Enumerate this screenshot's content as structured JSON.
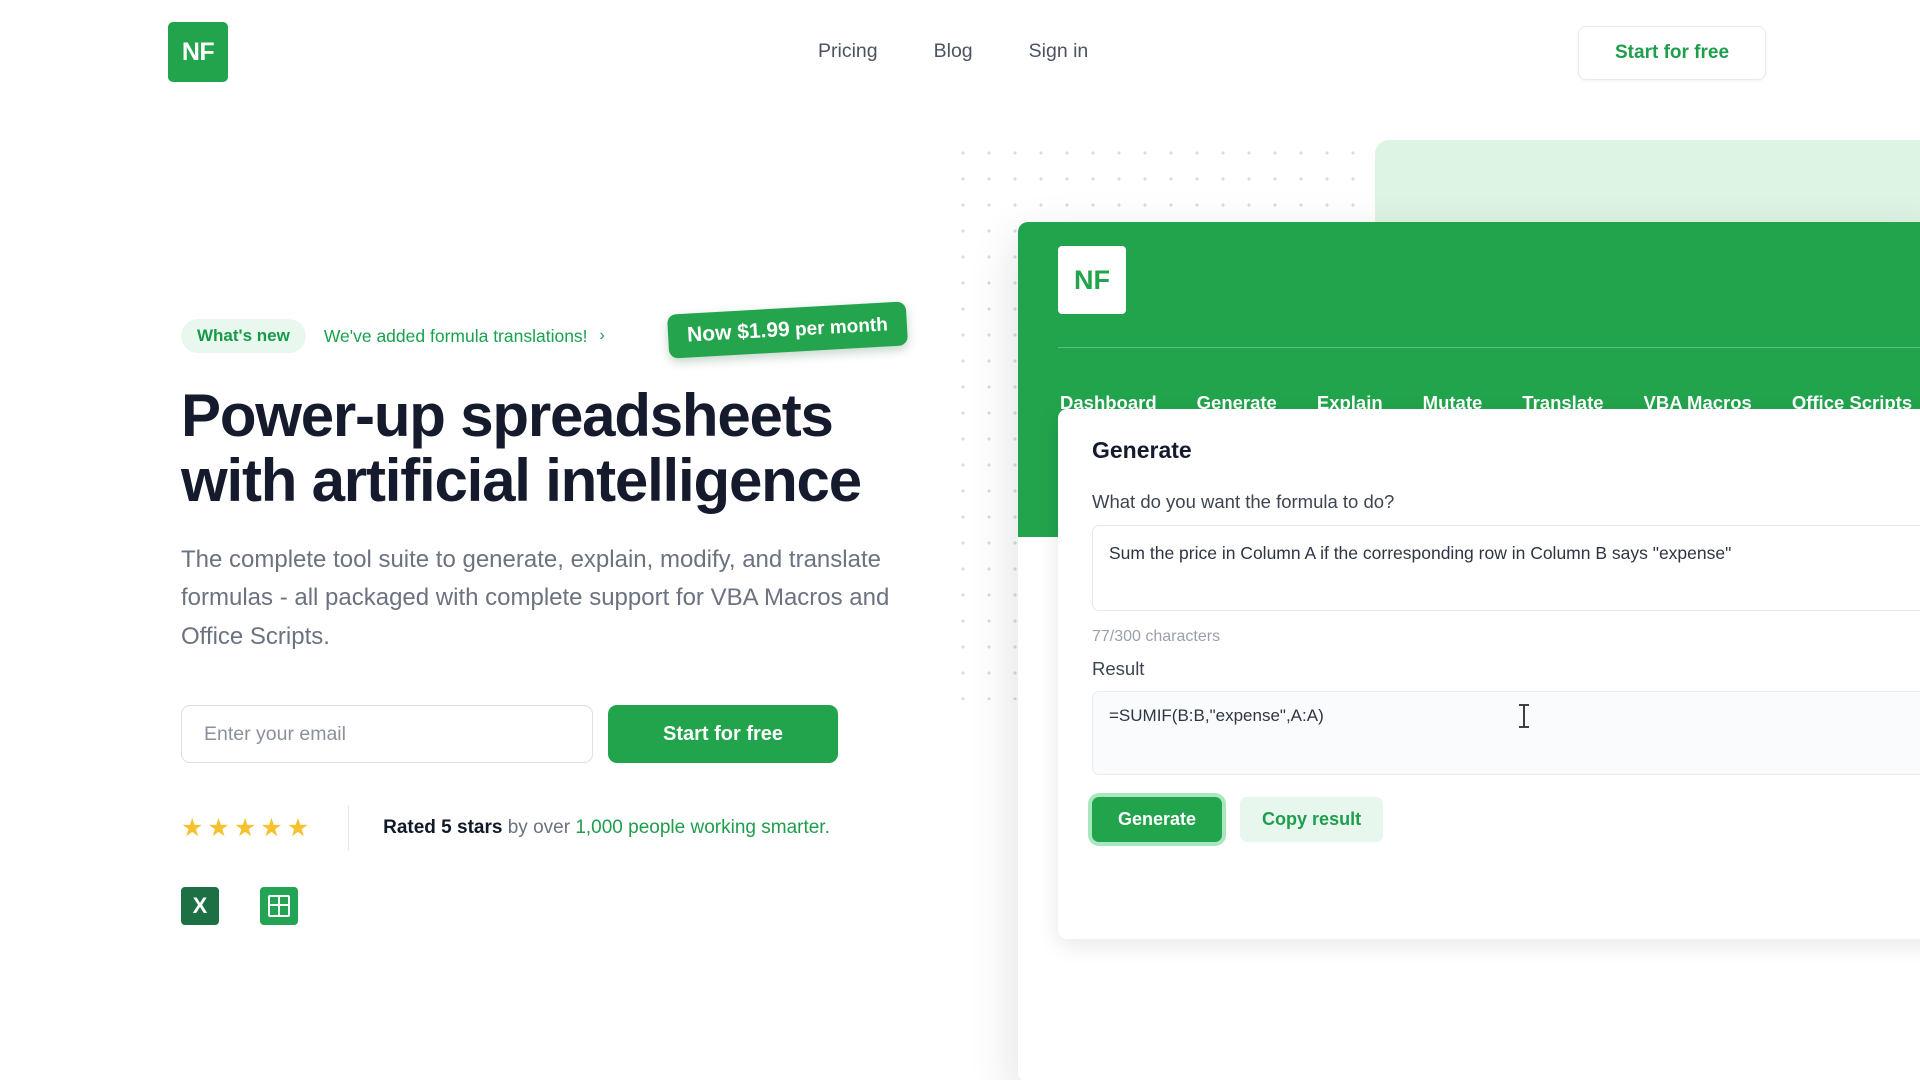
{
  "brand": {
    "logo_text": "NF",
    "accent_green": "#22a44c",
    "dark_navy": "#151b2d",
    "muted_gray": "#6b7280",
    "star_yellow": "#f5c12e"
  },
  "header": {
    "nav": [
      {
        "label": "Pricing"
      },
      {
        "label": "Blog"
      },
      {
        "label": "Sign in"
      }
    ],
    "cta_label": "Start for free"
  },
  "hero": {
    "whats_new_label": "What's new",
    "announce_text": "We've added formula translations!",
    "announce_chevron": "chevron-right-icon",
    "price_badge_strong": "Now $1.99",
    "price_badge_rest": " per month",
    "headline_line1": "Power-up spreadsheets",
    "headline_line2": "with artificial intelligence",
    "subheadline": "The complete tool suite to generate, explain, modify, and translate formulas - all packaged with complete support for VBA Macros and Office Scripts.",
    "email_placeholder": "Enter your email",
    "email_value": "",
    "signup_label": "Start for free",
    "stars": "★★★★★",
    "star_count": 5,
    "rating_bold": "Rated 5 stars",
    "rating_mid": " by over ",
    "rating_green": "1,000 people working smarter.",
    "app_badges": [
      {
        "name": "excel-icon",
        "glyph": "X"
      },
      {
        "name": "google-sheets-icon",
        "glyph": ""
      }
    ]
  },
  "app_mock": {
    "logo_text": "NF",
    "tabs": [
      {
        "label": "Dashboard"
      },
      {
        "label": "Generate"
      },
      {
        "label": "Explain"
      },
      {
        "label": "Mutate"
      },
      {
        "label": "Translate"
      },
      {
        "label": "VBA Macros"
      },
      {
        "label": "Office Scripts"
      }
    ],
    "card": {
      "title": "Generate",
      "prompt_label": "What do you want the formula to do?",
      "prompt_value": "Sum the price in Column A if the corresponding row in Column B says \"expense\"",
      "char_count": "77/300 characters",
      "result_label": "Result",
      "result_value": "=SUMIF(B:B,\"expense\",A:A)",
      "generate_label": "Generate",
      "copy_label": "Copy result"
    }
  }
}
